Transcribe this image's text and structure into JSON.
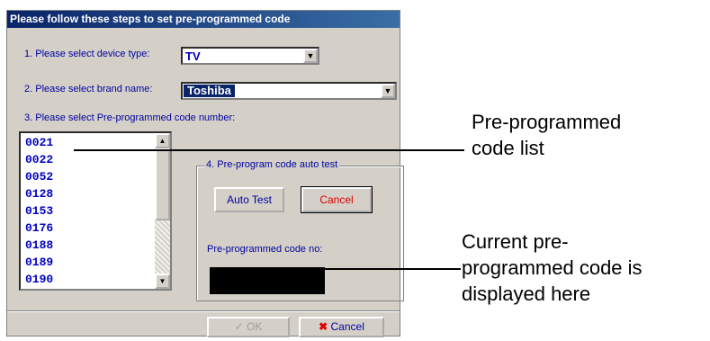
{
  "dialog": {
    "title": "Please follow these steps to set pre-programmed code",
    "step1_label": "1. Please select device type:",
    "device_type": "TV",
    "step2_label": "2. Please select brand name:",
    "brand_name": "Toshiba",
    "step3_label": "3. Please select Pre-programmed code number:",
    "codes": [
      "0021",
      "0022",
      "0052",
      "0128",
      "0153",
      "0176",
      "0188",
      "0189",
      "0190"
    ],
    "group_label": "4. Pre-program code auto test",
    "auto_test_label": "Auto Test",
    "cancel_test_label": "Cancel",
    "code_no_label": "Pre-programmed code no:",
    "ok_label": "OK",
    "cancel_label": "Cancel"
  },
  "annotations": {
    "list_callout": [
      "Pre-programmed",
      "code list"
    ],
    "display_callout": [
      "Current pre-",
      "programmed code is",
      "displayed here"
    ]
  },
  "colors": {
    "title_bar": "#0a246a",
    "label_text": "#0000a0",
    "list_text": "#0000c0",
    "cancel_red": "#e00000",
    "code_display": "#000000"
  }
}
